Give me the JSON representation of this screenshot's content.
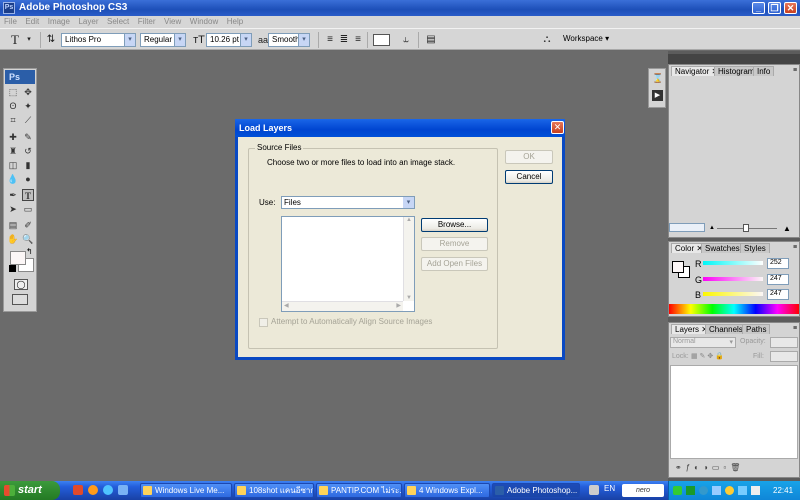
{
  "window": {
    "title": "Adobe Photoshop CS3"
  },
  "menu": [
    "File",
    "Edit",
    "Image",
    "Layer",
    "Select",
    "Filter",
    "View",
    "Window",
    "Help"
  ],
  "options": {
    "font_family": "Lithos Pro",
    "font_style": "Regular",
    "font_size": "10.26 pt",
    "antialias_prefix": "aa",
    "antialias": "Smooth",
    "workspace_label": "Workspace"
  },
  "toolbox": {
    "logo": "Ps"
  },
  "dialog": {
    "title": "Load Layers",
    "group_label": "Source Files",
    "description": "Choose two or more files to load into an image stack.",
    "use_label": "Use:",
    "use_value": "Files",
    "ok_label": "OK",
    "cancel_label": "Cancel",
    "browse_label": "Browse...",
    "remove_label": "Remove",
    "add_open_label": "Add Open Files",
    "align_label": "Attempt to Automatically Align Source Images"
  },
  "panels": {
    "navigator_tabs": [
      "Navigator",
      "Histogram",
      "Info"
    ],
    "color_tabs": [
      "Color",
      "Swatches",
      "Styles"
    ],
    "color": {
      "r_label": "R",
      "g_label": "G",
      "b_label": "B",
      "r": "252",
      "g": "247",
      "b": "247"
    },
    "layers_tabs": [
      "Layers",
      "Channels",
      "Paths"
    ],
    "layers": {
      "blend": "Normal",
      "opacity_label": "Opacity:",
      "lock_label": "Lock:",
      "fill_label": "Fill:"
    }
  },
  "taskbar": {
    "start": "start",
    "tasks": [
      "Windows Live Me...",
      "108shot แคนอีซาก...",
      "PANTIP.COM ไม่ระ...",
      "4 Windows Expl...",
      "Adobe Photoshop..."
    ],
    "lang": "EN",
    "search_brand": "nero",
    "clock": "22:41"
  }
}
